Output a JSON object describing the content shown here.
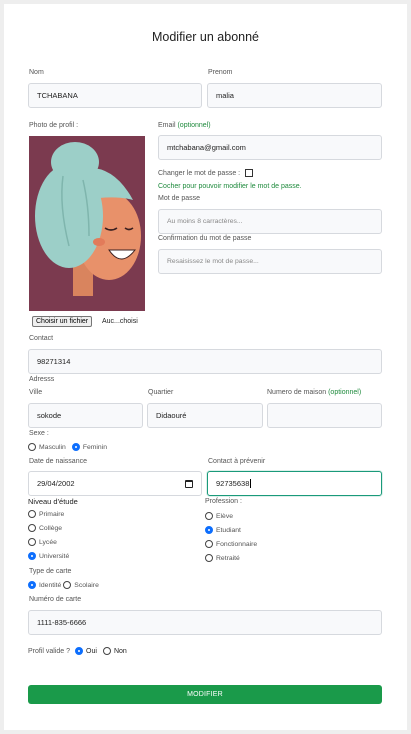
{
  "title": "Modifier un abonné",
  "nom": {
    "label": "Nom",
    "value": "TCHABANA"
  },
  "prenom": {
    "label": "Prenom",
    "value": "malia"
  },
  "photo": {
    "label": "Photo de profil :",
    "file_button": "Choisir un fichier",
    "file_text": "Auc...choisi"
  },
  "email": {
    "label": "Email",
    "optional": "(optionnel)",
    "value": "mtchabana@gmail.com"
  },
  "change_pw": {
    "label": "Changer le mot de passe :",
    "hint": "Cocher pour pouvoir modifier le mot de passe."
  },
  "password": {
    "label": "Mot de passe",
    "placeholder": "Au moins 8 carractères..."
  },
  "password_confirm": {
    "label": "Confirmation du mot de passe",
    "placeholder": "Resaisissez le mot de passe..."
  },
  "contact": {
    "label": "Contact",
    "value": "98271314"
  },
  "address": {
    "label": "Adresss"
  },
  "ville": {
    "label": "Ville",
    "value": "sokode"
  },
  "quartier": {
    "label": "Quartier",
    "value": "Didaouré"
  },
  "maison": {
    "label": "Numero de maison",
    "optional": "(optionnel)",
    "value": ""
  },
  "sexe": {
    "label": "Sexe :",
    "options": [
      "Masculin",
      "Feminin"
    ],
    "selected": "Feminin"
  },
  "birth": {
    "label": "Date de naissance",
    "value": "29/04/2002"
  },
  "emergency": {
    "label": "Contact à prévenir",
    "value": "92735638"
  },
  "niveau": {
    "label": "Niveau d'étude",
    "options": [
      "Primaire",
      "Collège",
      "Lycée",
      "Université"
    ],
    "selected": "Université"
  },
  "profession": {
    "label": "Profession :",
    "options": [
      "Elève",
      "Etudiant",
      "Fonctionnaire",
      "Retraité"
    ],
    "selected": "Etudiant"
  },
  "carte_type": {
    "label": "Type de carte",
    "options": [
      "Identité",
      "Scolaire"
    ],
    "selected": "Identité"
  },
  "carte_num": {
    "label": "Numéro de carte",
    "value": "1111-835-6666"
  },
  "profil_valide": {
    "label": "Profil valide ?",
    "options": [
      "Oui",
      "Non"
    ],
    "selected": "Oui"
  },
  "submit_label": "MODIFIER",
  "colors": {
    "accent_green": "#1a9a4a",
    "focus_teal": "#1a9a7a",
    "radio_blue": "#0d6efd",
    "photo_bg": "#7b3a4f"
  }
}
